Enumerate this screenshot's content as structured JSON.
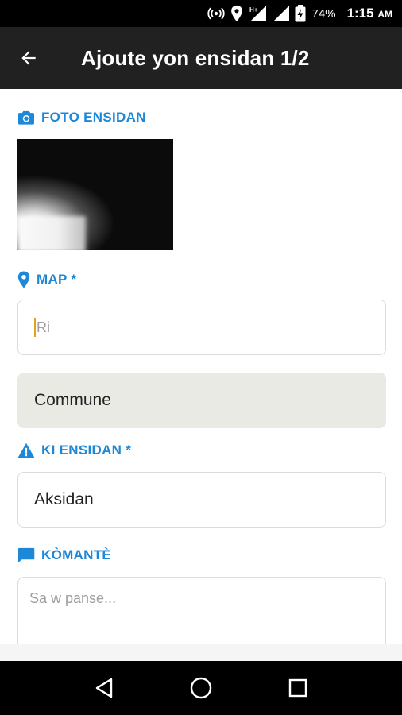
{
  "status_bar": {
    "battery": "74%",
    "time": "1:15",
    "ampm": "AM",
    "network": "H+",
    "icons": [
      "hotspot-icon",
      "location-icon",
      "signal-h-plus-icon",
      "signal-icon",
      "battery-charging-icon"
    ]
  },
  "app_bar": {
    "title": "Ajoute yon ensidan 1/2",
    "back_icon": "arrow-back-icon"
  },
  "sections": {
    "photo": {
      "label": "FOTO ENSIDAN",
      "icon": "camera-icon"
    },
    "map": {
      "label": "MAP *",
      "icon": "location-pin-icon",
      "street_placeholder": "Ri",
      "commune_value": "Commune"
    },
    "incident": {
      "label": "KI ENSIDAN *",
      "icon": "warning-icon",
      "value": "Aksidan"
    },
    "comment": {
      "label": "KÒMANTÈ",
      "icon": "comment-icon",
      "placeholder": "Sa w panse..."
    }
  },
  "nav_bar": {
    "icons": [
      "back-triangle-icon",
      "home-circle-icon",
      "recents-square-icon"
    ]
  },
  "colors": {
    "accent": "#1e88d8",
    "app_bar": "#212121",
    "disabled_field": "#e9eae4",
    "caret": "#e3a21a"
  }
}
